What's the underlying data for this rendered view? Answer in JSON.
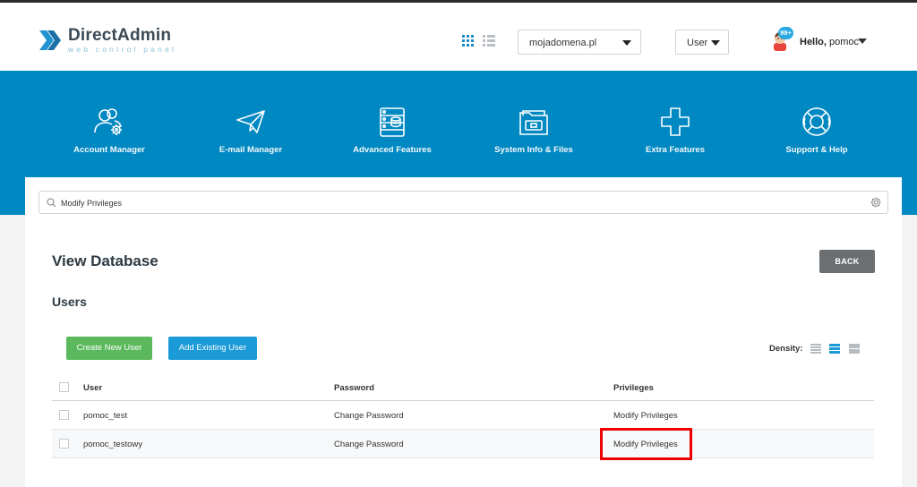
{
  "app": {
    "brand_name": "DirectAdmin",
    "brand_tagline": "web control panel",
    "accent_color": "#0088c2"
  },
  "header": {
    "view_toggle": {
      "grid_icon": "grid-view-icon",
      "list_icon": "list-view-icon",
      "active": "grid"
    },
    "domain_select": {
      "value": "mojadomena.pl"
    },
    "role_select": {
      "value": "User"
    },
    "notifications_badge": "99+",
    "greeting_prefix": "Hello,",
    "username": "pomoc"
  },
  "nav": {
    "items": [
      {
        "label": "Account Manager",
        "icon": "account-manager-icon"
      },
      {
        "label": "E-mail Manager",
        "icon": "paper-plane-icon"
      },
      {
        "label": "Advanced Features",
        "icon": "server-icon"
      },
      {
        "label": "System Info & Files",
        "icon": "folder-icon"
      },
      {
        "label": "Extra Features",
        "icon": "plus-icon"
      },
      {
        "label": "Support & Help",
        "icon": "lifebuoy-icon"
      }
    ]
  },
  "search": {
    "value": "Modify Privileges"
  },
  "page": {
    "title": "View Database",
    "back_label": "BACK",
    "section_title": "Users",
    "create_label": "Create New User",
    "add_existing_label": "Add Existing User",
    "density_label": "Density:",
    "density_active": "medium"
  },
  "table": {
    "headers": {
      "user": "User",
      "password": "Password",
      "privileges": "Privileges"
    },
    "rows": [
      {
        "user": "pomoc_test",
        "password": "Change Password",
        "privileges": "Modify Privileges"
      },
      {
        "user": "pomoc_testowy",
        "password": "Change Password",
        "privileges": "Modify Privileges"
      }
    ]
  }
}
